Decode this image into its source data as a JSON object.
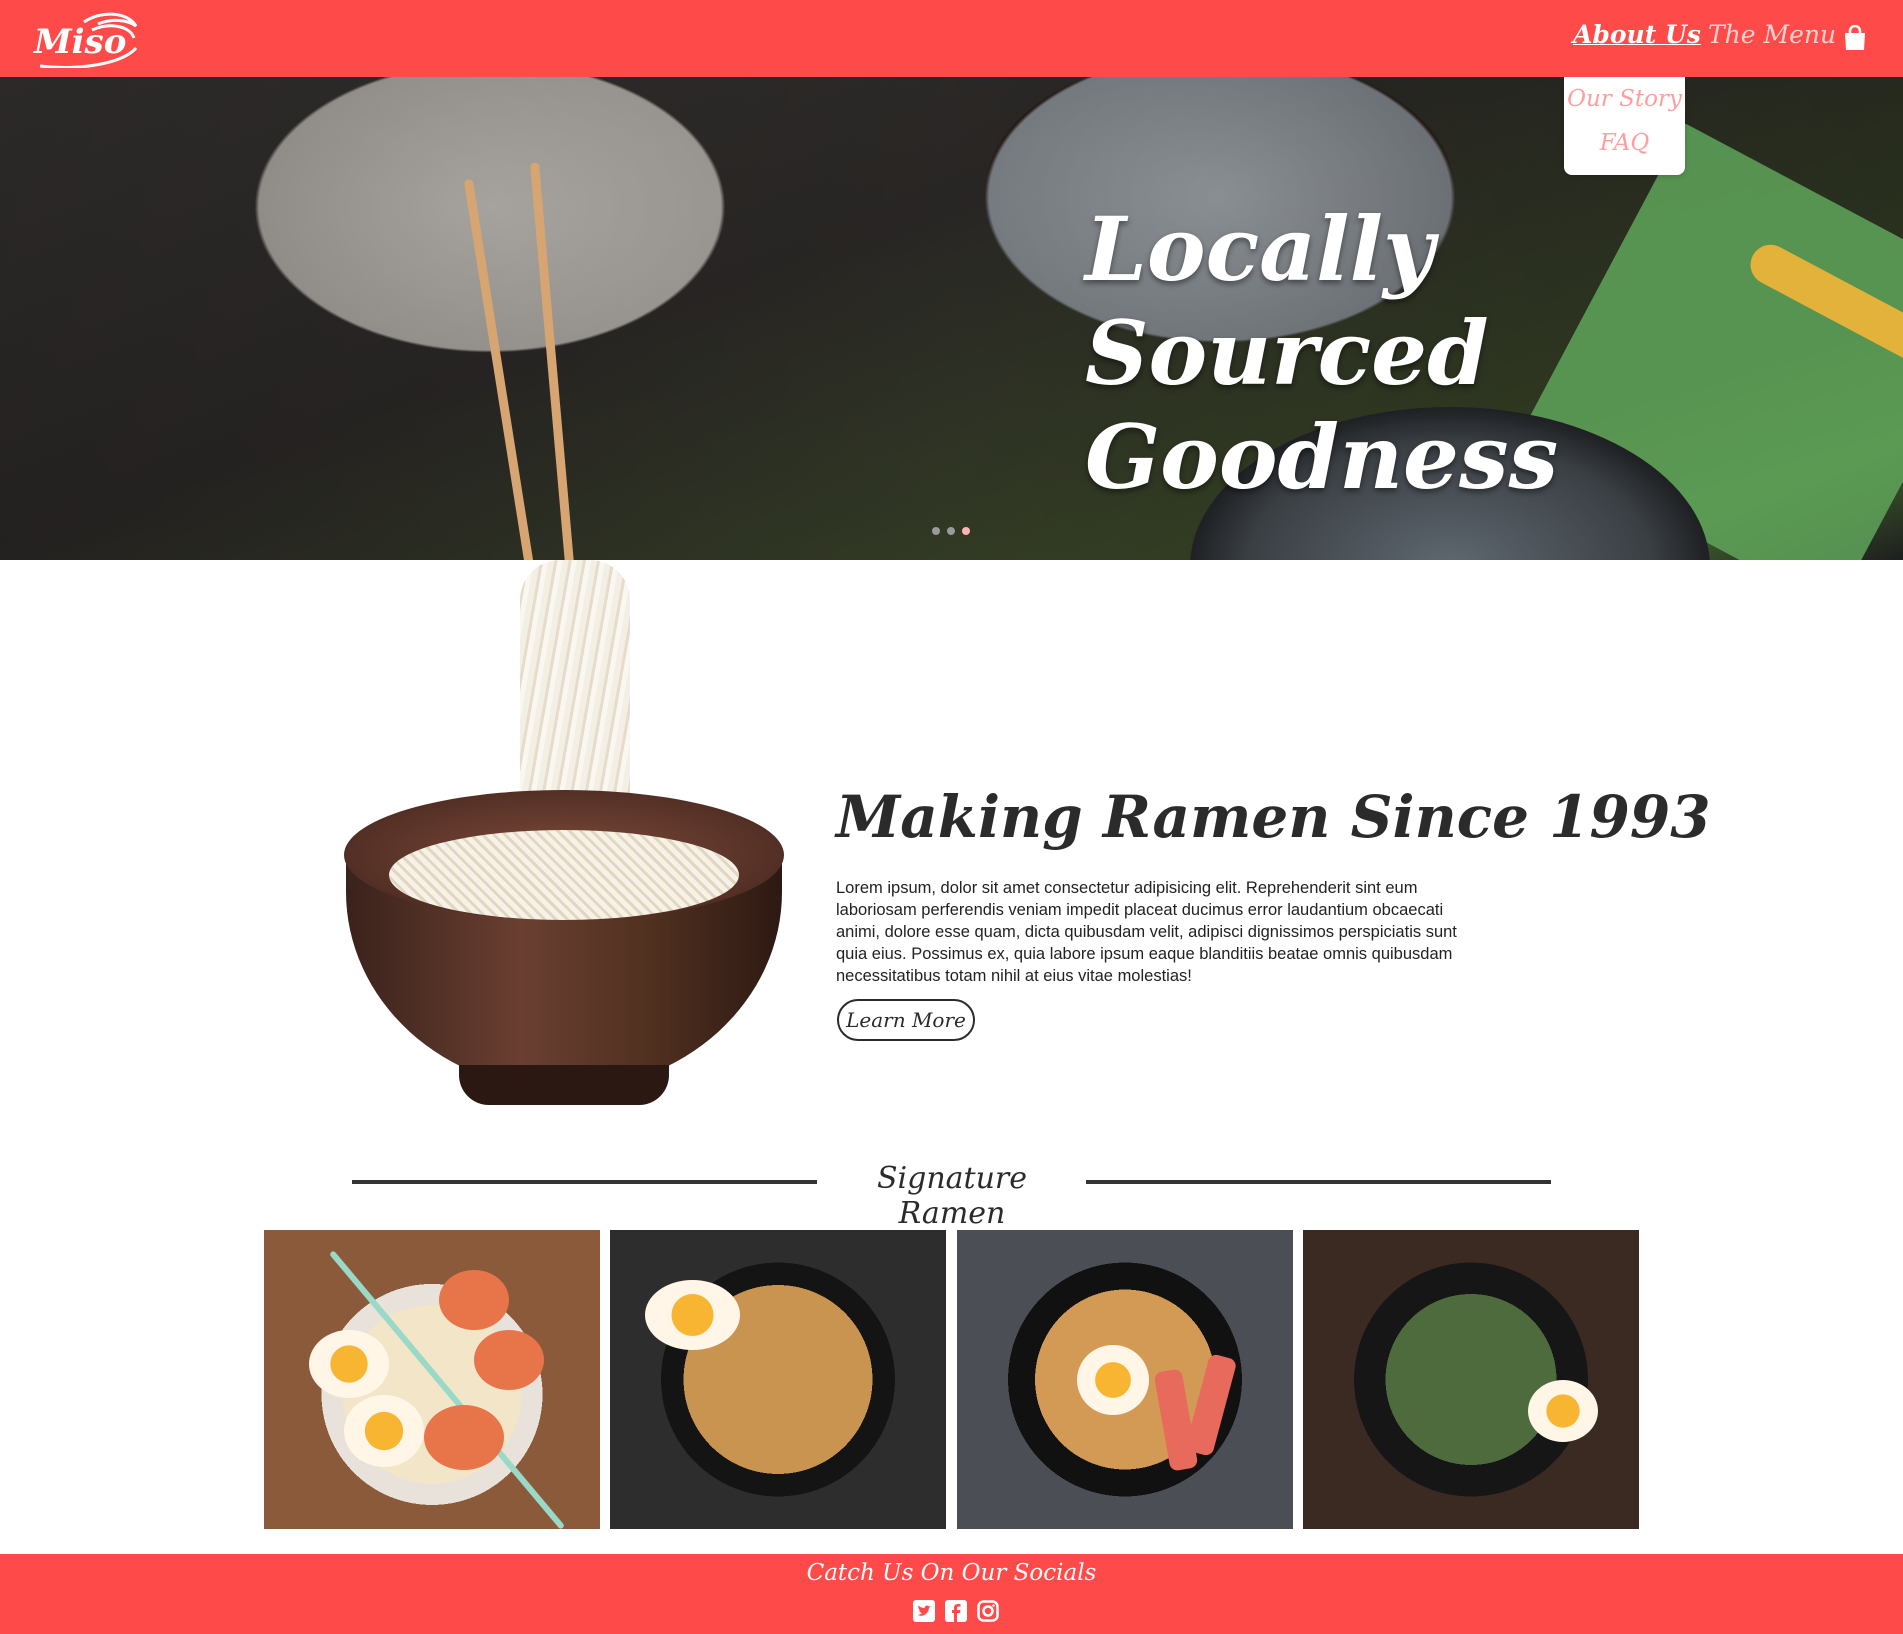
{
  "brand": {
    "logo_text": "Miso"
  },
  "nav": {
    "about_label": "About Us",
    "menu_label": "The Menu",
    "cart_icon": "shopping-bag-icon",
    "dropdown": [
      "Our Story",
      "FAQ"
    ]
  },
  "hero": {
    "title": "Locally Sourced Goodness",
    "dots": 3,
    "active_dot": 3
  },
  "about": {
    "title": "Making Ramen Since 1993",
    "body": "Lorem ipsum, dolor sit amet consectetur adipisicing elit. Reprehenderit sint eum laboriosam perferendis veniam impedit placeat ducimus error laudantium obcaecati animi, dolore esse quam, dicta quibusdam velit, adipisci dignissimos perspiciatis sunt quia eius. Possimus ex, quia labore ipsum eaque blanditiis beatae omnis quibusdam necessitatibus totam nihil at eius vitae molestias!",
    "button_label": "Learn More"
  },
  "signature": {
    "title": "Signature Ramen",
    "items": [
      "shrimp-ramen-photo",
      "spicy-noodle-photo",
      "crab-ramen-photo",
      "pork-ramen-photo"
    ]
  },
  "footer": {
    "title": "Catch Us On Our Socials",
    "socials": [
      "twitter-icon",
      "facebook-icon",
      "instagram-icon"
    ]
  },
  "colors": {
    "brand_red": "#ff4a4a",
    "accent_pink": "#ff9e9e",
    "text_dark": "#2b2b2b"
  }
}
